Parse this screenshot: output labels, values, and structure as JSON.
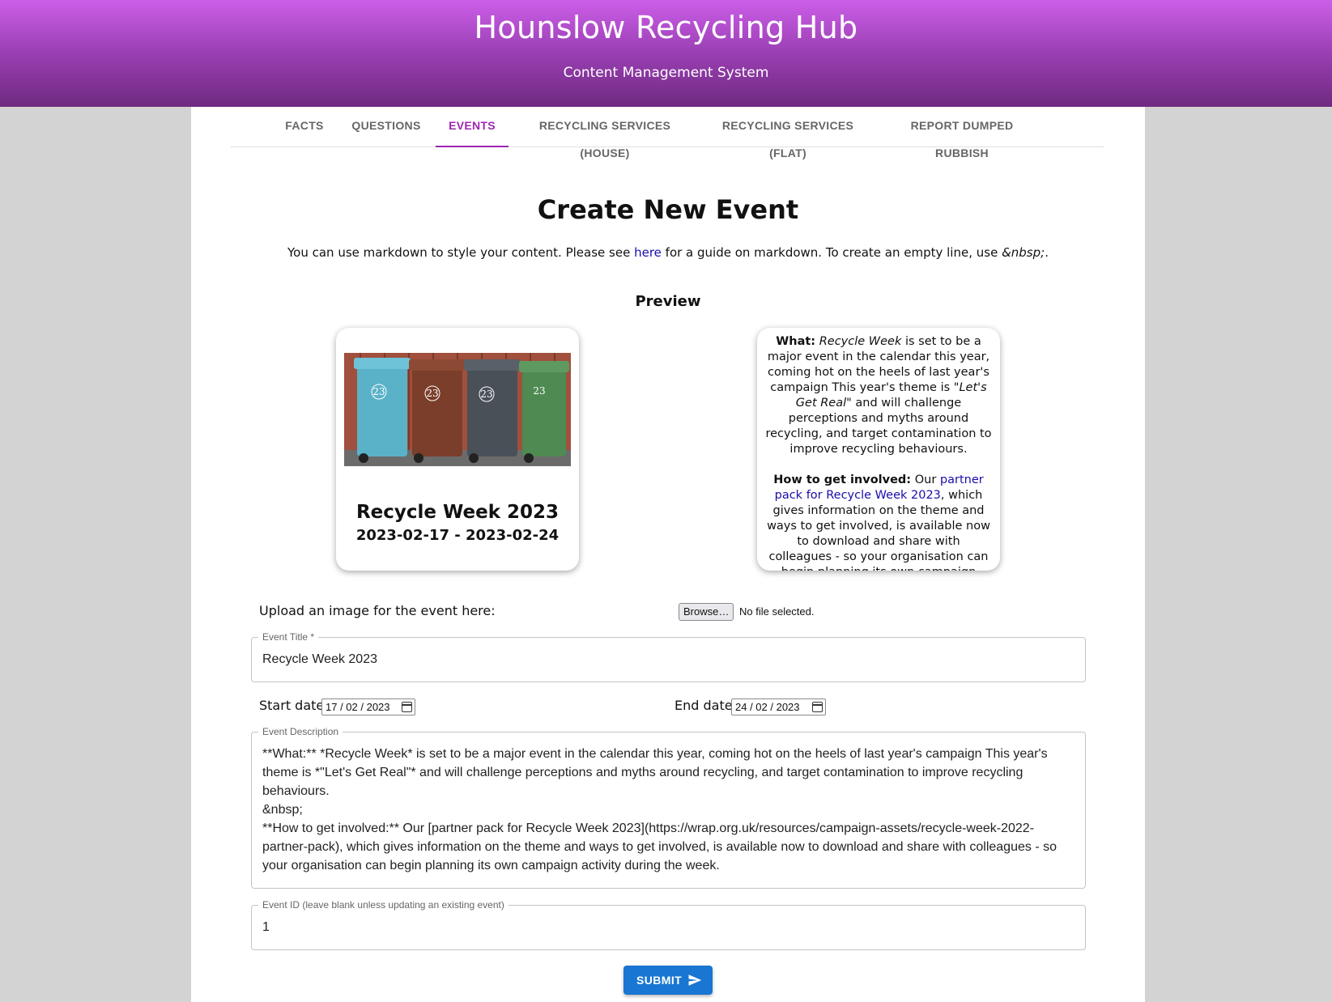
{
  "header": {
    "title": "Hounslow Recycling Hub",
    "subtitle": "Content Management System",
    "colors": {
      "gradient_top": "#cc5ee8",
      "gradient_bottom": "#6e2a80",
      "accent": "#9c27b0"
    }
  },
  "tabs": [
    {
      "label": "Facts",
      "active": false
    },
    {
      "label": "Questions",
      "active": false
    },
    {
      "label": "Events",
      "active": true
    },
    {
      "label": "Recycling Services (House)",
      "active": false
    },
    {
      "label": "Recycling Services (Flat)",
      "active": false
    },
    {
      "label": "Report Dumped Rubbish",
      "active": false
    }
  ],
  "page": {
    "title": "Create New Event",
    "hint_prefix": "You can use markdown to style your content. Please see ",
    "hint_link": "here",
    "hint_middle": " for a guide on markdown. To create an empty line, use ",
    "hint_code": "&nbsp;",
    "hint_suffix": ".",
    "preview_label": "Preview"
  },
  "preview": {
    "card_title": "Recycle Week 2023",
    "card_dates": "2023-02-17 - 2023-02-24",
    "image_icon": "wheelie-bins-photo",
    "bin_number": "23",
    "what_label": "What:",
    "what_em": "Recycle Week",
    "what_text": " is set to be a major event in the calendar this year, coming hot on the heels of last year's campaign This year's theme is ",
    "what_theme": "\"Let's Get Real\"",
    "what_text2": " and will challenge perceptions and myths around recycling, and target contamination to improve recycling behaviours.",
    "how_label": "How to get involved:",
    "how_text": " Our ",
    "how_link": "partner pack for Recycle Week 2023",
    "how_text2": ", which gives information on the theme and ways to get involved, is available now to download and share with colleagues - so your organisation can begin planning its own campaign activity during the week."
  },
  "form": {
    "upload_label": "Upload an image for the event here:",
    "browse_label": "Browse…",
    "no_file": "No file selected.",
    "title_legend": "Event Title *",
    "title_value": "Recycle Week 2023",
    "start_label": "Start date:",
    "start_value": "17 / 02 / 2023",
    "end_label": "End date:",
    "end_value": "24 / 02 / 2023",
    "desc_legend": "Event Description",
    "desc_value": "**What:** *Recycle Week* is set to be a major event in the calendar this year, coming hot on the heels of last year's campaign This year's theme is *\"Let's Get Real\"* and will challenge perceptions and myths around recycling, and target contamination to improve recycling behaviours.\n&nbsp;\n**How to get involved:** Our [partner pack for Recycle Week 2023](https://wrap.org.uk/resources/campaign-assets/recycle-week-2022-partner-pack), which gives information on the theme and ways to get involved, is available now to download and share with colleagues - so your organisation can begin planning its own campaign activity during the week.",
    "id_legend": "Event ID (leave blank unless updating an existing event)",
    "id_value": "1",
    "submit_label": "SUBMIT",
    "submit_color": "#1976d2"
  }
}
